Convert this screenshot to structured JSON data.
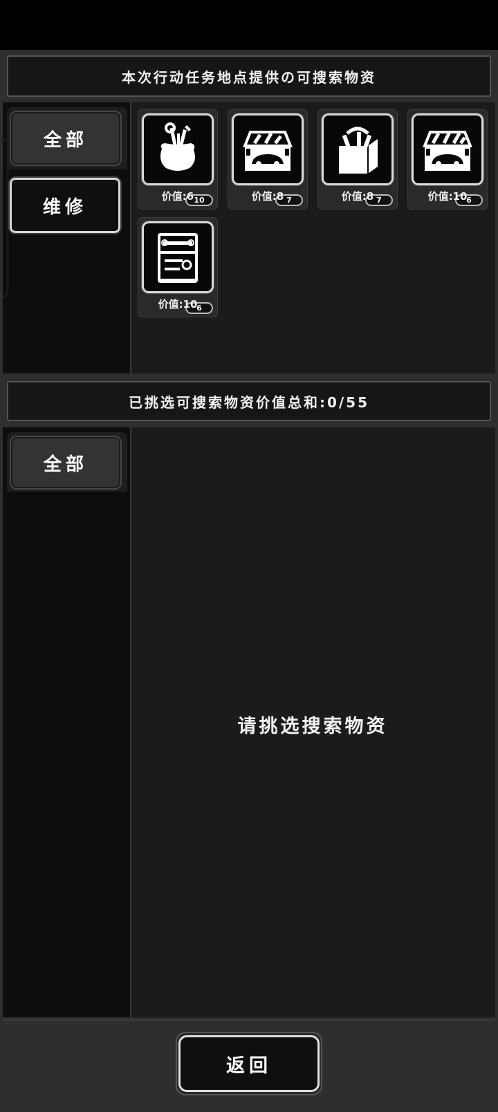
{
  "top_section": {
    "header": "本次行动任务地点提供の可搜索物资",
    "tabs": [
      {
        "label": "全部",
        "selected": false
      },
      {
        "label": "维修",
        "selected": true
      }
    ],
    "items": [
      {
        "icon": "tool-bag-icon",
        "count": "10",
        "value": "价值:6"
      },
      {
        "icon": "car-toolbox-icon",
        "count": "7",
        "value": "价值:8"
      },
      {
        "icon": "tool-box-icon",
        "count": "7",
        "value": "价值:8"
      },
      {
        "icon": "car-toolbox-icon",
        "count": "6",
        "value": "价值:10"
      },
      {
        "icon": "tool-kit-case-icon",
        "count": "6",
        "value": "价值:10"
      }
    ]
  },
  "bottom_section": {
    "header": "已挑选可搜索物资价值总和:0/55",
    "tabs": [
      {
        "label": "全部",
        "selected": false
      }
    ],
    "empty_message": "请挑选搜索物资"
  },
  "footer": {
    "back_label": "返回"
  },
  "colors": {
    "background": "#2e2e2e",
    "panel": "#1b1b1b",
    "side_panel": "#0d0d0d",
    "accent_border": "#d9d9d9"
  }
}
